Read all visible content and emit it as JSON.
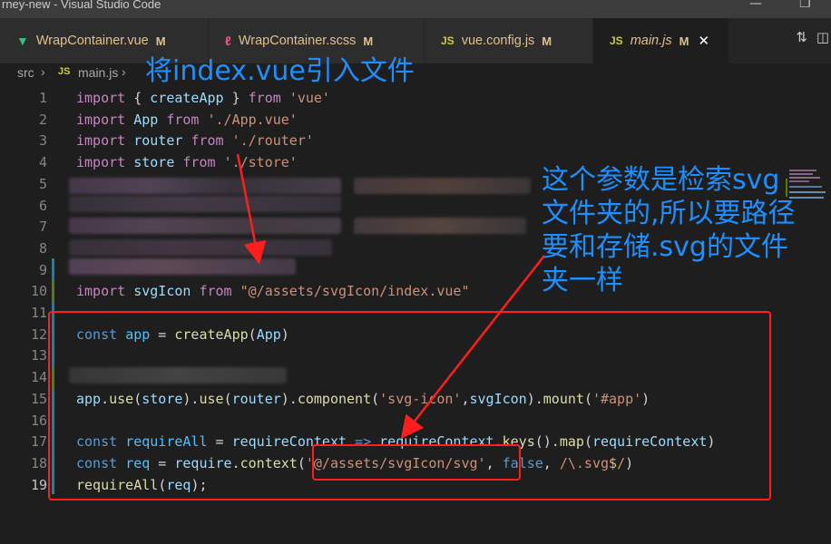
{
  "window": {
    "title": "rney-new - Visual Studio Code"
  },
  "tabs": [
    {
      "icon": "vue-icon",
      "label": "WrapContainer.vue",
      "modified": "M",
      "active": false
    },
    {
      "icon": "scss-icon",
      "label": "WrapContainer.scss",
      "modified": "M",
      "active": false
    },
    {
      "icon": "js-icon",
      "label": "vue.config.js",
      "modified": "M",
      "active": false
    },
    {
      "icon": "js-icon",
      "label": "main.js",
      "modified": "M",
      "active": true
    }
  ],
  "icon_text": {
    "js": "JS"
  },
  "breadcrumb": {
    "folder": "src",
    "file": "main.js"
  },
  "code": {
    "line_numbers": [
      "1",
      "2",
      "3",
      "4",
      "5",
      "6",
      "7",
      "8",
      "9",
      "10",
      "11",
      "12",
      "13",
      "14",
      "15",
      "16",
      "17",
      "18",
      "19"
    ],
    "l1": [
      "import",
      " { ",
      "createApp",
      " } ",
      "from",
      " ",
      "'vue'"
    ],
    "l2": [
      "import",
      " ",
      "App",
      " ",
      "from",
      " ",
      "'./App.vue'"
    ],
    "l3": [
      "import",
      " ",
      "router",
      " ",
      "from",
      " ",
      "'./router'"
    ],
    "l4": [
      "import",
      " ",
      "store",
      " ",
      "from",
      " ",
      "'./store'"
    ],
    "l10": [
      "import",
      " ",
      "svgIcon",
      " ",
      "from",
      " ",
      "\"@/assets/svgIcon/index.vue\""
    ],
    "l12": [
      "const",
      " ",
      "app",
      " = ",
      "createApp",
      "(",
      "App",
      ")"
    ],
    "l15": [
      "app",
      ".",
      "use",
      "(",
      "store",
      ").",
      "use",
      "(",
      "router",
      ").",
      "component",
      "(",
      "'svg-icon'",
      ",",
      "svgIcon",
      ").",
      "mount",
      "(",
      "'#app'",
      ")"
    ],
    "l17": [
      "const",
      " ",
      "requireAll",
      " = ",
      "requireContext",
      " => ",
      "requireContext",
      ".",
      "keys",
      "().",
      "map",
      "(",
      "requireContext",
      ")"
    ],
    "l18": [
      "const",
      " ",
      "req",
      " = ",
      "require",
      ".",
      "context",
      "(",
      "'@/assets/svgIcon/svg'",
      ", ",
      "false",
      ", ",
      "/\\.svg",
      "$",
      "/",
      ")"
    ],
    "l19": [
      "requireAll",
      "(",
      "req",
      ");"
    ]
  },
  "annotations": {
    "top": "将index.vue引入文件",
    "right": "这个参数是检索svg\n文件夹的,所以要路径\n要和存储.svg的文件\n夹一样"
  },
  "colors": {
    "annotation": "#1e8fff",
    "highlight_box": "#ff1e1e",
    "modified": "#e2c08d"
  }
}
